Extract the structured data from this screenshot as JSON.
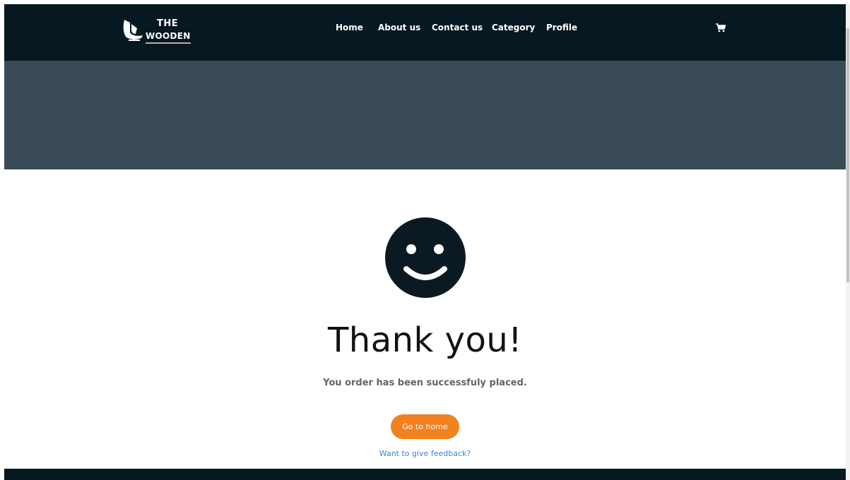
{
  "brand": {
    "line1": "THE",
    "line2": "WOODEN",
    "logo_icon": "chair-icon"
  },
  "nav": {
    "items": [
      {
        "label": "Home"
      },
      {
        "label": "About us"
      },
      {
        "label": "Contact us"
      },
      {
        "label": "Category"
      },
      {
        "label": "Profile"
      }
    ],
    "cart_icon": "cart-icon"
  },
  "colors": {
    "navbar": "#061820",
    "hero": "#384b56",
    "accent": "#f28120",
    "link": "#3d7fd6",
    "smiley": "#0b1a22"
  },
  "confirmation": {
    "icon": "smiley-icon",
    "title": "Thank you!",
    "message": "You order has been successfuly placed.",
    "home_button": "Go to home",
    "feedback_link": "Want to give feedback?"
  }
}
